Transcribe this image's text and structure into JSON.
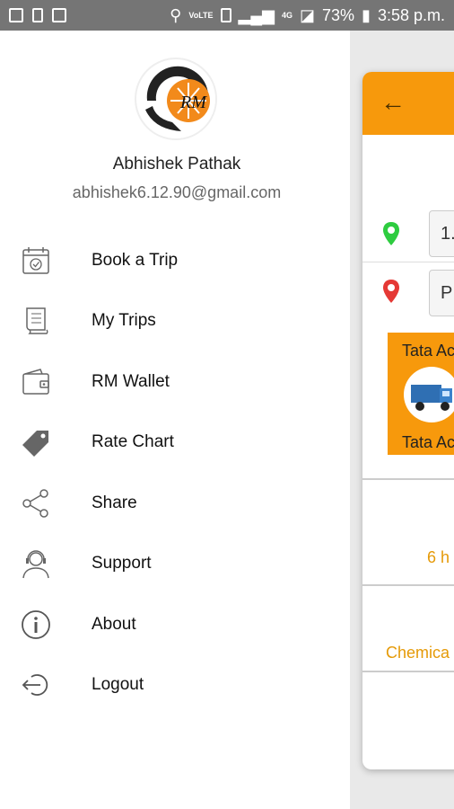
{
  "status_bar": {
    "signal_tag": "VoLTE",
    "network": "4G",
    "battery": "73%",
    "time": "3:58 p.m."
  },
  "drawer": {
    "user_name": "Abhishek Pathak",
    "user_email": "abhishek6.12.90@gmail.com",
    "avatar_letters": "RM",
    "menu": [
      {
        "label": "Book a Trip",
        "icon": "calendar-icon"
      },
      {
        "label": "My Trips",
        "icon": "scroll-icon"
      },
      {
        "label": "RM Wallet",
        "icon": "wallet-icon"
      },
      {
        "label": "Rate Chart",
        "icon": "price-tag-icon"
      },
      {
        "label": "Share",
        "icon": "share-icon"
      },
      {
        "label": "Support",
        "icon": "support-agent-icon"
      },
      {
        "label": "About",
        "icon": "info-icon"
      },
      {
        "label": "Logout",
        "icon": "logout-icon"
      }
    ]
  },
  "background_screen": {
    "pickup_value": "1.",
    "drop_value": "P",
    "vehicle_top": "Tata Ac",
    "vehicle_bottom": "Tata Ac",
    "duration_text": "6 h",
    "goods_text": "Chemica"
  },
  "colors": {
    "accent": "#f7990c",
    "status_bar": "#757575",
    "pin_green": "#2ecc40",
    "pin_red": "#e53935"
  }
}
